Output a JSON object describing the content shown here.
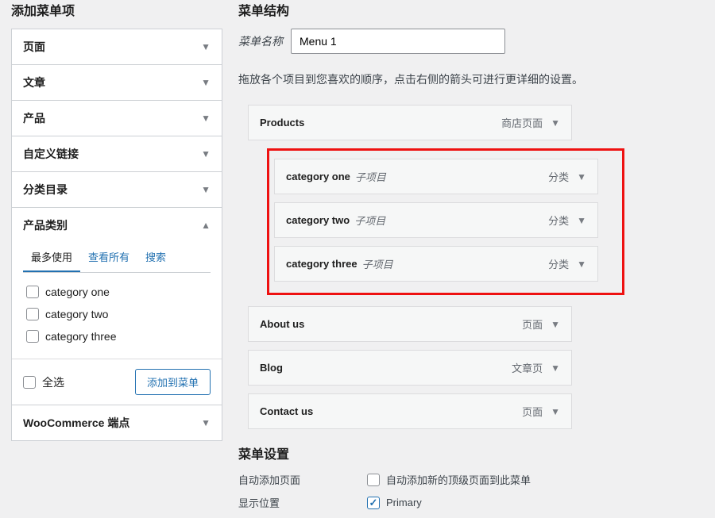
{
  "sidebar": {
    "title": "添加菜单项",
    "panels": [
      {
        "label": "页面",
        "open": false
      },
      {
        "label": "文章",
        "open": false
      },
      {
        "label": "产品",
        "open": false
      },
      {
        "label": "自定义链接",
        "open": false
      },
      {
        "label": "分类目录",
        "open": false
      }
    ],
    "product_cat": {
      "label": "产品类别",
      "tabs": {
        "active": "最多使用",
        "all": "查看所有",
        "search": "搜索"
      },
      "items": [
        {
          "label": "category one"
        },
        {
          "label": "category two"
        },
        {
          "label": "category three"
        }
      ],
      "select_all": "全选",
      "add_btn": "添加到菜单"
    },
    "woo_panel": {
      "label": "WooCommerce 端点"
    }
  },
  "main": {
    "title": "菜单结构",
    "menu_name_label": "菜单名称",
    "menu_name_value": "Menu 1",
    "hint": "拖放各个项目到您喜欢的顺序，点击右侧的箭头可进行更详细的设置。",
    "items": {
      "products": {
        "title": "Products",
        "type": "商店页面"
      },
      "cat1": {
        "title": "category one",
        "sub": "子项目",
        "type": "分类"
      },
      "cat2": {
        "title": "category two",
        "sub": "子项目",
        "type": "分类"
      },
      "cat3": {
        "title": "category three",
        "sub": "子项目",
        "type": "分类"
      },
      "about": {
        "title": "About us",
        "type": "页面"
      },
      "blog": {
        "title": "Blog",
        "type": "文章页"
      },
      "contact": {
        "title": "Contact us",
        "type": "页面"
      }
    },
    "settings": {
      "heading": "菜单设置",
      "auto_add_label": "自动添加页面",
      "auto_add_desc": "自动添加新的顶级页面到此菜单",
      "location_label": "显示位置",
      "location_opt": "Primary"
    }
  }
}
